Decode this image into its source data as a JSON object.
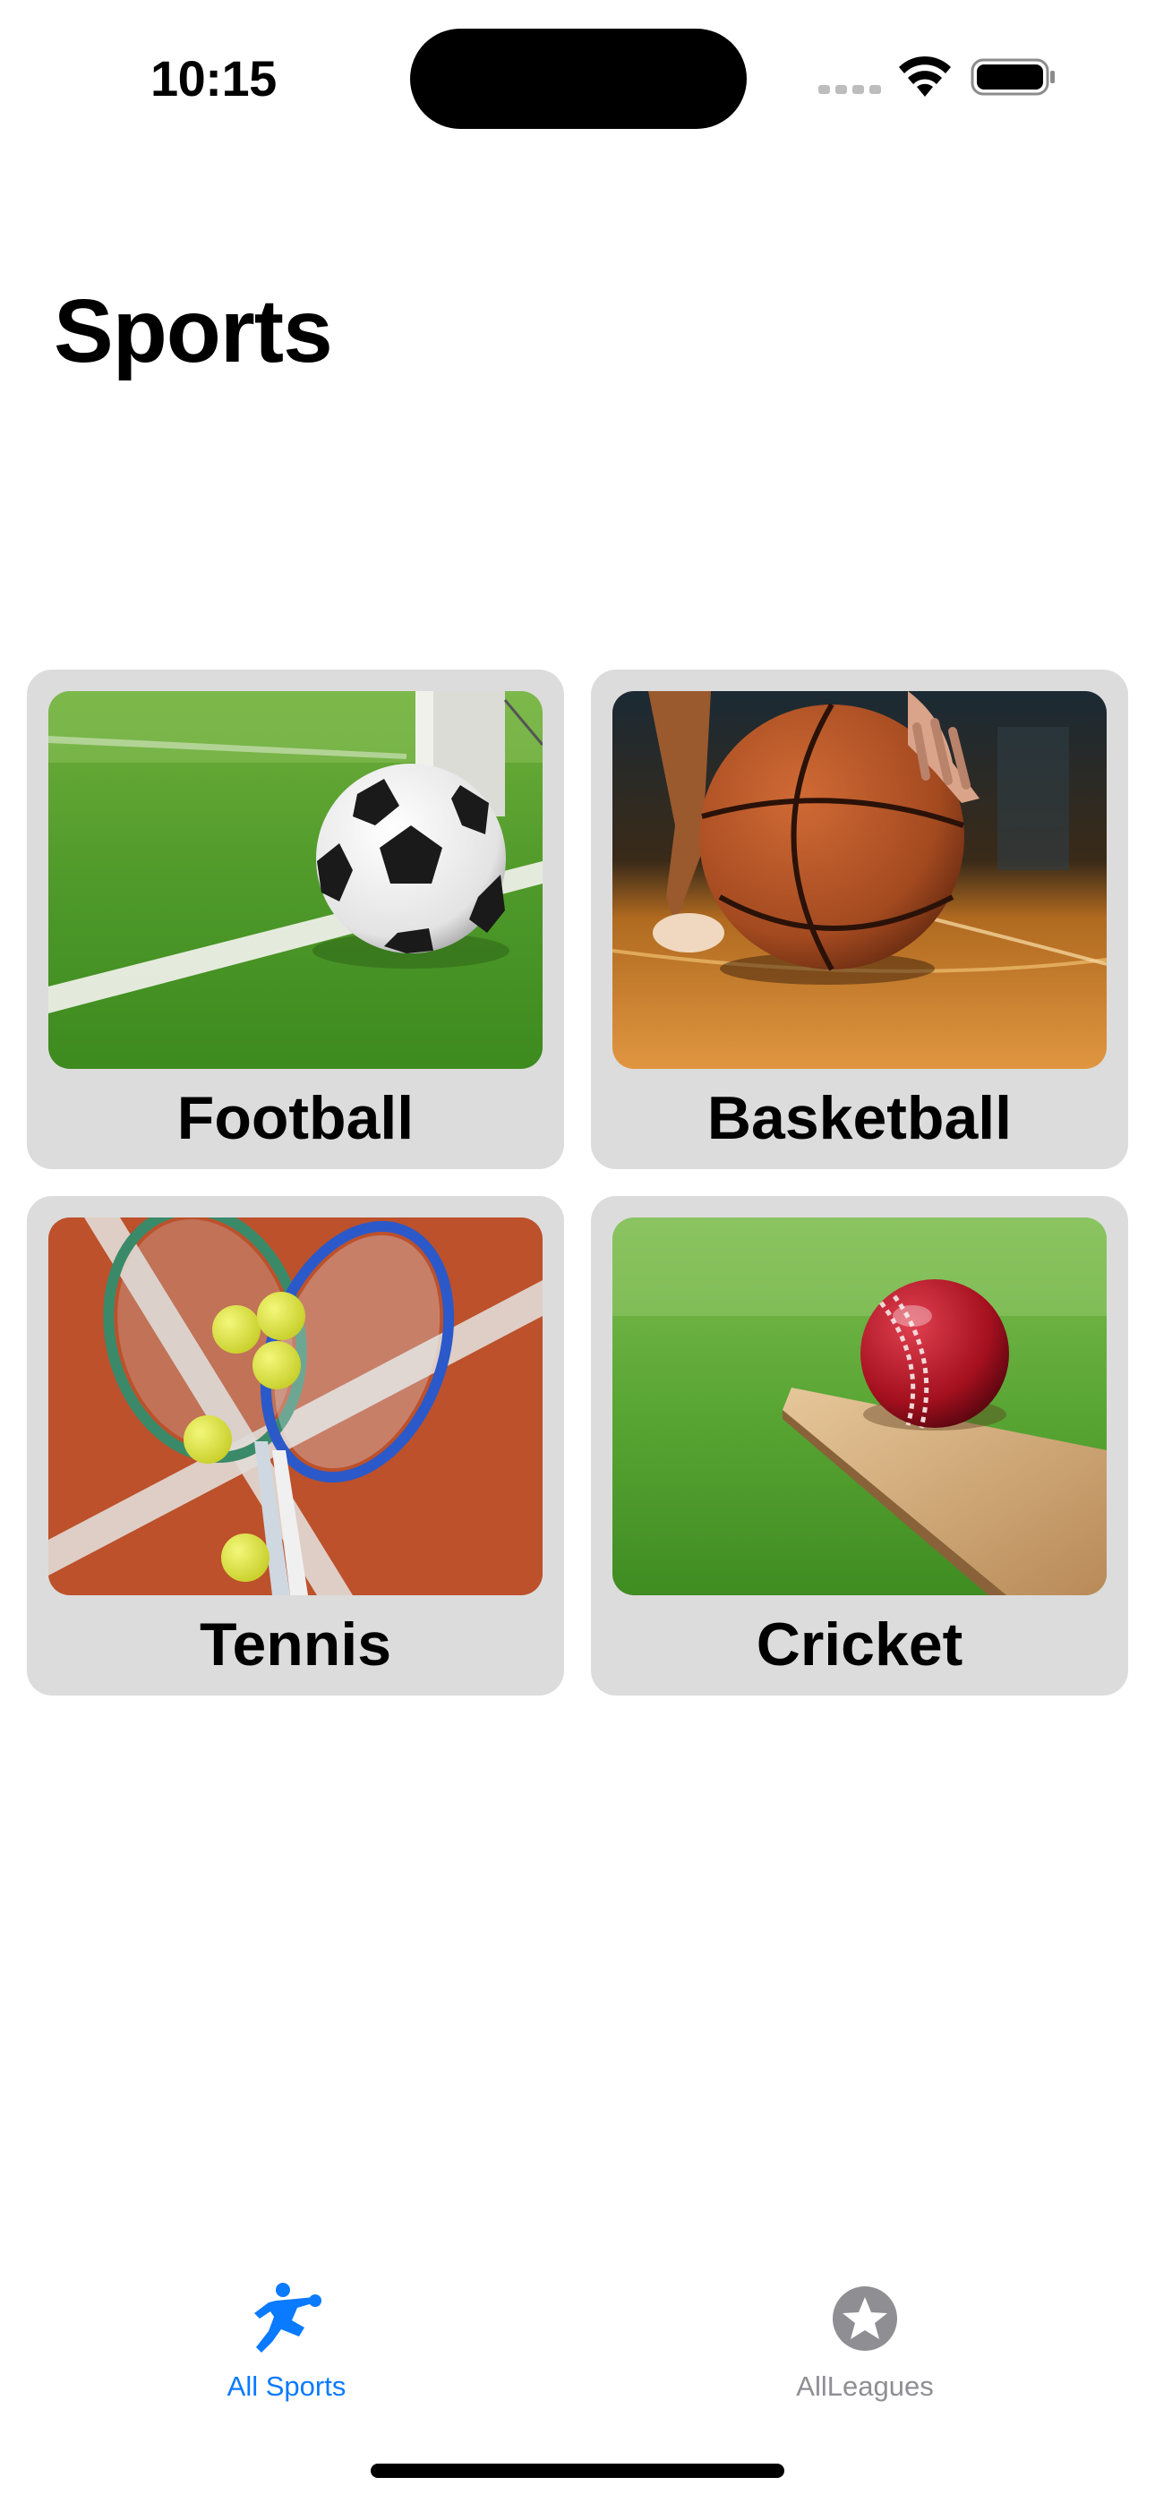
{
  "status_bar": {
    "time": "10:15"
  },
  "header": {
    "title": "Sports"
  },
  "sports": [
    {
      "label": "Football",
      "image": "soccer-ball-on-grass-photo"
    },
    {
      "label": "Basketball",
      "image": "basketball-on-court-photo"
    },
    {
      "label": "Tennis",
      "image": "tennis-rackets-and-balls-photo"
    },
    {
      "label": "Cricket",
      "image": "cricket-ball-on-bat-photo"
    }
  ],
  "tab_bar": {
    "tabs": [
      {
        "label": "All Sports",
        "icon": "running-figure-icon",
        "selected": true
      },
      {
        "label": "AllLeagues",
        "icon": "star-circle-icon",
        "selected": false
      }
    ]
  },
  "colors": {
    "accent": "#0a7aff",
    "tab_inactive": "#8e8e93",
    "card_background": "#dcdcdc",
    "background": "#ffffff"
  }
}
